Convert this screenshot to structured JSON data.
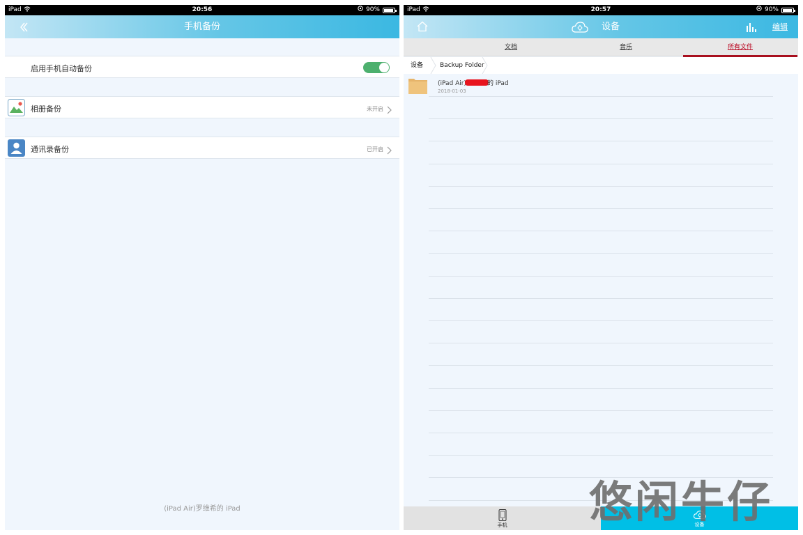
{
  "left": {
    "statusbar": {
      "carrier": "iPad",
      "time": "20:56",
      "battery": "90%",
      "battery_level": 0.9
    },
    "navbar": {
      "title": "手机备份"
    },
    "rows": {
      "auto_backup": {
        "label": "启用手机自动备份",
        "toggle_on": true
      },
      "album": {
        "label": "相册备份",
        "status": "未开启"
      },
      "contacts": {
        "label": "通讯录备份",
        "status": "已开启"
      }
    },
    "device_name": "(iPad Air)罗维希的 iPad"
  },
  "right": {
    "statusbar": {
      "carrier": "iPad",
      "time": "20:57",
      "battery": "90%",
      "battery_level": 0.9
    },
    "navbar": {
      "title": "设备",
      "edit_label": "编辑"
    },
    "tabs": [
      {
        "label": "文档",
        "active": false
      },
      {
        "label": "音乐",
        "active": false
      },
      {
        "label": "所有文件",
        "active": true
      }
    ],
    "breadcrumb": [
      "设备",
      "Backup Folder"
    ],
    "files": [
      {
        "name_prefix": "(iPad Air)",
        "name_suffix": "的 iPad",
        "date": "2018-01-03"
      }
    ],
    "tabbar": {
      "phone_label": "手机",
      "device_label": "设备"
    }
  },
  "watermark": "悠闲牛仔",
  "colors": {
    "toggle": "#4db06e",
    "active_tab": "#a80f1e",
    "tabbar_active": "#00bfe6",
    "navbar": "#3bb8e2"
  }
}
